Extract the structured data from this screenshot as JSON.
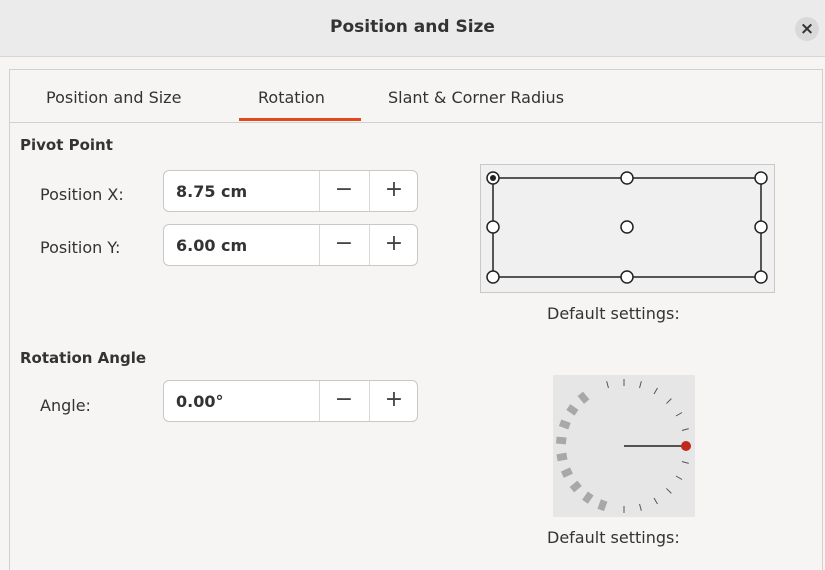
{
  "window": {
    "title": "Position and Size",
    "close_glyph": "×"
  },
  "tabs": [
    {
      "label": "Position and Size",
      "active": false
    },
    {
      "label": "Rotation",
      "active": true
    },
    {
      "label": "Slant & Corner Radius",
      "active": false
    }
  ],
  "accent_color": "#e0481e",
  "pivot": {
    "heading": "Pivot Point",
    "position_x": {
      "label": "Position X:",
      "value": "8.75 cm"
    },
    "position_y": {
      "label": "Position Y:",
      "value": "6.00 cm"
    },
    "default_label": "Default settings:",
    "selected_point": "top-left"
  },
  "rotation": {
    "heading": "Rotation Angle",
    "angle": {
      "label": "Angle:",
      "value": "0.00°"
    },
    "default_label": "Default settings:"
  },
  "spin": {
    "minus": "−",
    "plus": "+"
  }
}
